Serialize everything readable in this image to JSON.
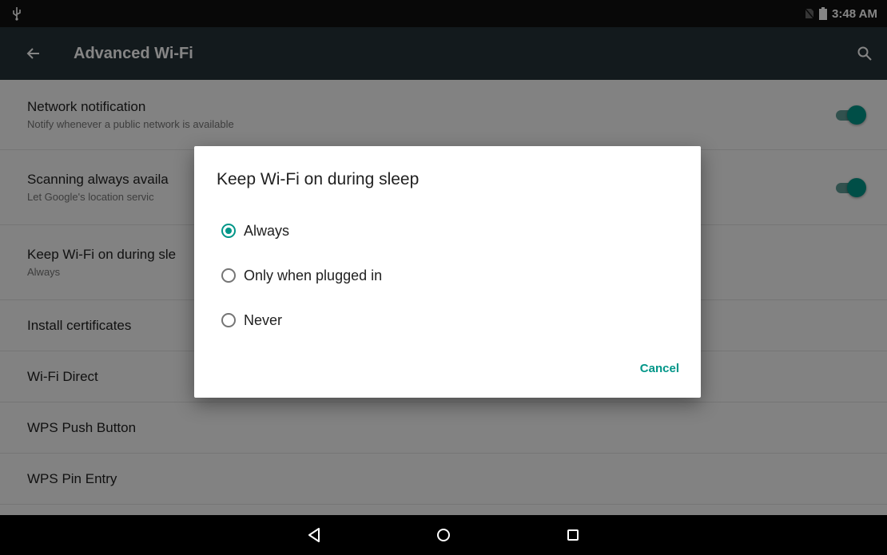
{
  "status_bar": {
    "time": "3:48 AM",
    "icons": [
      "usb-icon",
      "no-sim-icon",
      "battery-icon"
    ]
  },
  "app_bar": {
    "title": "Advanced Wi-Fi",
    "icons": [
      "back-arrow-icon",
      "search-icon"
    ]
  },
  "settings": [
    {
      "title": "Network notification",
      "subtitle": "Notify whenever a public network is available",
      "toggle": true
    },
    {
      "title": "Scanning always availa",
      "subtitle": "Let Google's location servic",
      "toggle": true
    },
    {
      "title": "Keep Wi-Fi on during sle",
      "subtitle": "Always"
    },
    {
      "title": "Install certificates"
    },
    {
      "title": "Wi-Fi Direct"
    },
    {
      "title": "WPS Push Button"
    },
    {
      "title": "WPS Pin Entry"
    }
  ],
  "dialog": {
    "title": "Keep Wi-Fi on during sleep",
    "options": [
      "Always",
      "Only when plugged in",
      "Never"
    ],
    "selected": "Always",
    "cancel_label": "Cancel"
  },
  "nav_bar": {
    "icons": [
      "back-triangle-icon",
      "home-circle-icon",
      "recents-square-icon"
    ]
  },
  "colors": {
    "accent": "#009688",
    "app_bar": "#263238",
    "status_bar": "#111111"
  }
}
